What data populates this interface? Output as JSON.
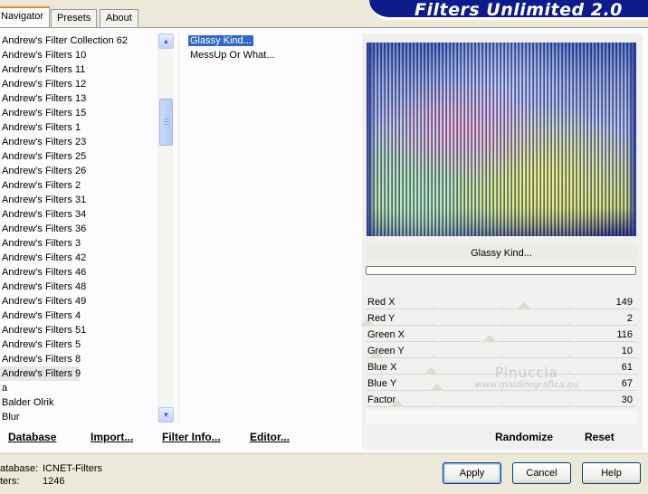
{
  "tabs": [
    {
      "label": "Navigator",
      "active": true
    },
    {
      "label": "Presets",
      "active": false
    },
    {
      "label": "About",
      "active": false
    }
  ],
  "banner": {
    "title": "Filters Unlimited 2.0",
    "color": "#0f1a8c"
  },
  "categories": [
    "Andrew's Filter Collection 62",
    "Andrew's Filters 10",
    "Andrew's Filters 11",
    "Andrew's Filters 12",
    "Andrew's Filters 13",
    "Andrew's Filters 15",
    "Andrew's Filters 1",
    "Andrew's Filters 23",
    "Andrew's Filters 25",
    "Andrew's Filters 26",
    "Andrew's Filters 2",
    "Andrew's Filters 31",
    "Andrew's Filters 34",
    "Andrew's Filters 36",
    "Andrew's Filters 3",
    "Andrew's Filters 42",
    "Andrew's Filters 46",
    "Andrew's Filters 48",
    "Andrew's Filters 49",
    "Andrew's Filters 4",
    "Andrew's Filters 51",
    "Andrew's Filters 5",
    "Andrew's Filters 8",
    "Andrew's Filters 9",
    "a",
    "Balder Olrik",
    "Blur"
  ],
  "selected_category": "Andrew's Filters 9",
  "filters": [
    "Glassy Kind...",
    "MessUp Or What..."
  ],
  "selected_filter": "Glassy Kind...",
  "preview": {
    "filter_name": "Glassy Kind..."
  },
  "params": [
    {
      "label": "Red X",
      "value": "149",
      "level": 0.584
    },
    {
      "label": "Red Y",
      "value": "2",
      "level": 0.008
    },
    {
      "label": "Green X",
      "value": "116",
      "level": 0.455
    },
    {
      "label": "Green Y",
      "value": "10",
      "level": 0.039
    },
    {
      "label": "Blue X",
      "value": "61",
      "level": 0.239
    },
    {
      "label": "Blue Y",
      "value": "67",
      "level": 0.263
    },
    {
      "label": "Factor",
      "value": "30",
      "level": 0.118
    }
  ],
  "watermark": {
    "line1": "Pinuccia",
    "line2": "www.maidiregrafica.eu"
  },
  "links": {
    "database": "Database",
    "import": "Import...",
    "filter_info": "Filter Info...",
    "editor": "Editor...",
    "randomize": "Randomize",
    "reset": "Reset"
  },
  "status": {
    "database_label": "atabase:",
    "database_value": "ICNET-Filters",
    "filters_label": "ters:",
    "filters_value": "1246"
  },
  "buttons": {
    "apply": "Apply",
    "cancel": "Cancel",
    "help": "Help"
  },
  "icons": {
    "scroll_up": "chevron-up-icon",
    "scroll_down": "chevron-down-icon"
  }
}
